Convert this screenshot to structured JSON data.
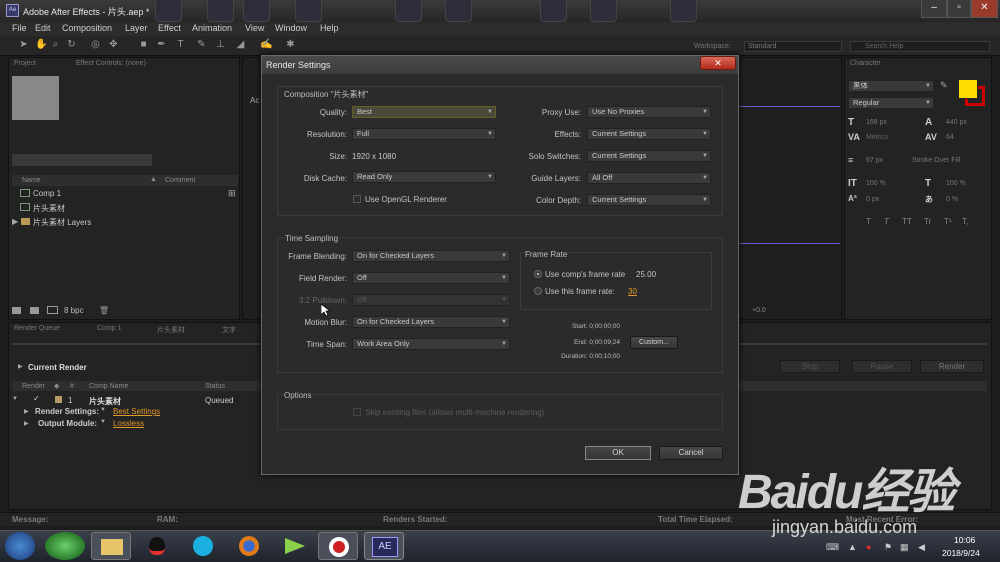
{
  "window": {
    "app_icon": "Ae",
    "title": "Adobe After Effects - 片头.aep *"
  },
  "menu": [
    "File",
    "Edit",
    "Composition",
    "Layer",
    "Effect",
    "Animation",
    "View",
    "Window",
    "Help"
  ],
  "toolbar": {
    "workspace_label": "Workspace:",
    "workspace_value": "Standard",
    "search_placeholder": "Search Help"
  },
  "project_panel": {
    "tab_project": "Project",
    "tab_effect_controls": "Effect Controls: (none)",
    "columns": [
      "Name",
      "Comment"
    ],
    "items": [
      "Comp 1",
      "片头素材",
      "片头素材 Layers"
    ],
    "bpc": "8 bpc"
  },
  "comp_panel_tab": "Ac",
  "character_panel": {
    "tab": "Character",
    "font": "黑体",
    "style": "Regular",
    "size": "168 px",
    "leading": "440 px",
    "kerning": "Metrics",
    "tracking": "64",
    "stroke": "67 px",
    "stroke_type": "Stroke Over Fill",
    "v_scale": "100 %",
    "h_scale": "100 %",
    "baseline": "0 px",
    "tsume": "0 %",
    "styles": [
      "T",
      "T",
      "TT",
      "Tr",
      "T¹",
      "T,"
    ],
    "fill_color": "#ffdd00",
    "stroke_color": "#cc0000"
  },
  "render_queue": {
    "tabs": [
      "Render Queue",
      "Comp 1",
      "片头素材",
      "文字"
    ],
    "current_render": "Current Render",
    "columns": [
      "Render",
      "#",
      "Comp Name",
      "Status"
    ],
    "item": {
      "num": "1",
      "name": "片头素材",
      "status": "Queued"
    },
    "render_settings_label": "Render Settings:",
    "render_settings_value": "Best Settings",
    "output_module_label": "Output Module:",
    "output_module_value": "Lossless",
    "buttons": [
      "Stop",
      "Pause",
      "Render"
    ]
  },
  "status_bar": {
    "message": "Message:",
    "ram": "RAM:",
    "renders_started": "Renders Started:",
    "total_time": "Total Time Elapsed:",
    "most_recent_error": "Most Recent Error:"
  },
  "dialog": {
    "title": "Render Settings",
    "close": "✕",
    "composition": {
      "title": "Composition \"片头素材\"",
      "quality_label": "Quality:",
      "quality": "Best",
      "resolution_label": "Resolution:",
      "resolution": "Full",
      "size_label": "Size:",
      "size": "1920 x 1080",
      "disk_cache_label": "Disk Cache:",
      "disk_cache": "Read Only",
      "opengl_label": "Use OpenGL Renderer",
      "proxy_label": "Proxy Use:",
      "proxy": "Use No Proxies",
      "effects_label": "Effects:",
      "effects": "Current Settings",
      "solo_label": "Solo Switches:",
      "solo": "Current Settings",
      "guide_label": "Guide Layers:",
      "guide": "All Off",
      "color_depth_label": "Color Depth:",
      "color_depth": "Current Settings"
    },
    "time_sampling": {
      "title": "Time Sampling",
      "frame_blending_label": "Frame Blending:",
      "frame_blending": "On for Checked Layers",
      "field_render_label": "Field Render:",
      "field_render": "Off",
      "pulldown_label": "3:2 Pulldown:",
      "pulldown": "Off",
      "motion_blur_label": "Motion Blur:",
      "motion_blur": "On for Checked Layers",
      "time_span_label": "Time Span:",
      "time_span": "Work Area Only",
      "frame_rate_title": "Frame Rate",
      "use_comp_rate": "Use comp's frame rate",
      "comp_rate_value": "25.00",
      "use_this_rate": "Use this frame rate:",
      "this_rate_value": "30",
      "start": "Start: 0;00;00;00",
      "end": "End: 0;00;09;24",
      "duration": "Duration: 0;00;10;00",
      "custom_button": "Custom..."
    },
    "options": {
      "title": "Options",
      "skip_existing": "Skip existing files (allows multi-machine rendering)"
    },
    "ok": "OK",
    "cancel": "Cancel"
  },
  "taskbar": {
    "time": "10:06",
    "date": "2018/9/24",
    "ae_label": "AE"
  },
  "watermark": {
    "logo": "Baidu经验",
    "url": "jingyan.baidu.com"
  }
}
